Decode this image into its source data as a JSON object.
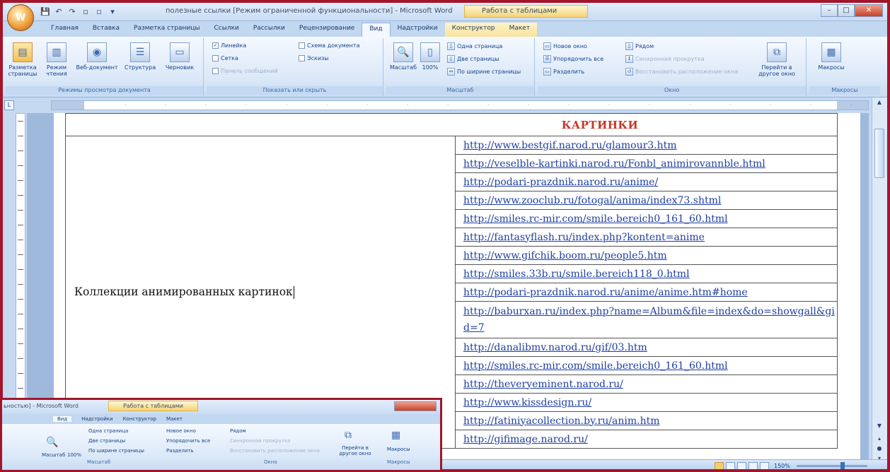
{
  "window": {
    "title": "полезные ссылки [Режим ограниченной функциональности] - Microsoft Word",
    "context_tab_title": "Работа с таблицами",
    "office_button": "W",
    "controls": {
      "minimize": "–",
      "maximize": "□",
      "close": "✕"
    }
  },
  "quick_access": [
    "💾",
    "↶",
    "↷",
    "▫",
    "▫",
    "▾"
  ],
  "tabs": [
    {
      "label": "Главная"
    },
    {
      "label": "Вставка"
    },
    {
      "label": "Разметка страницы"
    },
    {
      "label": "Ссылки"
    },
    {
      "label": "Рассылки"
    },
    {
      "label": "Рецензирование"
    },
    {
      "label": "Вид"
    },
    {
      "label": "Надстройки"
    },
    {
      "label": "Конструктор"
    },
    {
      "label": "Макет"
    }
  ],
  "ribbon": {
    "views_group": {
      "label": "Режимы просмотра документа",
      "buttons": [
        "Разметка страницы",
        "Режим чтения",
        "Веб-документ",
        "Структура",
        "Черновик"
      ]
    },
    "show_group": {
      "label": "Показать или скрыть",
      "items": [
        "Линейка",
        "Сетка",
        "Панель сообщений",
        "Схема документа",
        "Эскизы"
      ]
    },
    "zoom_group": {
      "label": "Масштаб",
      "buttons": [
        "Масштаб",
        "100%"
      ],
      "items": [
        "Одна страница",
        "Две страницы",
        "По ширине страницы"
      ]
    },
    "window_group": {
      "label": "Окно",
      "items": [
        "Новое окно",
        "Упорядочить все",
        "Разделить",
        "Рядом",
        "Синхронная прокрутка",
        "Восстановить расположение окна"
      ],
      "switch_label": "Перейти в другое окно"
    },
    "macros_group": {
      "label": "Макросы",
      "button": "Макросы"
    }
  },
  "document": {
    "heading": "КАРТИНКИ",
    "left_text": "Коллекции анимированных картинок",
    "links": [
      "http://www.bestgif.narod.ru/glamour3.htm",
      "http://veselble-kartinki.narod.ru/Fonbl_animirovannble.html",
      "http://podari-prazdnik.narod.ru/anime/",
      "http://www.zooclub.ru/fotogal/anima/index73.shtml",
      "http://smiles.rc-mir.com/smile.bereich0_161_60.html",
      "http://fantasyflash.ru/index.php?kontent=anime",
      "http://www.gifchik.boom.ru/people5.htm",
      "http://smiles.33b.ru/smile.bereich118_0.html",
      "http://podari-prazdnik.narod.ru/anime/anime.htm#home",
      "http://baburxan.ru/index.php?name=Album&file=index&do=showgall&gid=7",
      "http://danalibmv.narod.ru/gif/03.htm",
      "http://smiles.rc-mir.com/smile.bereich0_161_60.html",
      "http://theveryeminent.narod.ru/",
      "http://www.kissdesign.ru/",
      "http://fatiniyacollection.by.ru/anim.htm",
      "http://gifimage.narod.ru/"
    ]
  },
  "status": {
    "zoom": "150%"
  },
  "inset": {
    "title": "ьностью] - Microsoft Word",
    "context_title": "Работа с таблицами",
    "tabs": [
      "Вид",
      "Надстройки",
      "Конструктор",
      "Макет"
    ]
  },
  "colors": {
    "frame": "#a3152a",
    "heading": "#c0392b",
    "link": "#1f3fa0",
    "ribbon": "#dbe8f8"
  }
}
